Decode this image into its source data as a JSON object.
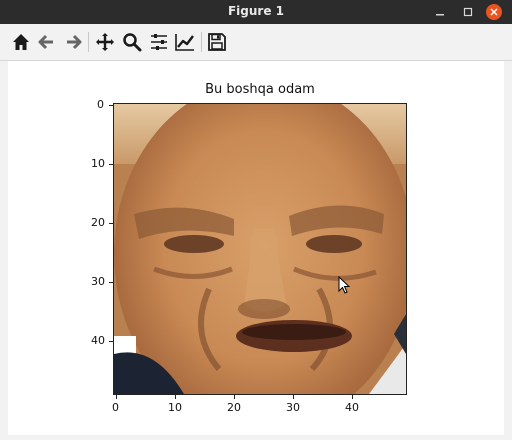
{
  "window": {
    "title": "Figure 1"
  },
  "toolbar": {
    "buttons": [
      {
        "name": "home-icon"
      },
      {
        "name": "back-arrow-icon"
      },
      {
        "name": "forward-arrow-icon"
      },
      {
        "name": "pan-icon"
      },
      {
        "name": "zoom-icon"
      },
      {
        "name": "configure-subplots-icon"
      },
      {
        "name": "edit-axis-icon"
      },
      {
        "name": "save-icon"
      }
    ]
  },
  "figure": {
    "title": "Bu boshqa odam",
    "image_description": "pixelated face image",
    "y_ticks": [
      "0",
      "10",
      "20",
      "30",
      "40"
    ],
    "x_ticks": [
      "0",
      "10",
      "20",
      "30",
      "40"
    ]
  },
  "colors": {
    "titlebar": "#2c2c2c",
    "close_button": "#e95420",
    "toolbar": "#f2f2f2"
  }
}
